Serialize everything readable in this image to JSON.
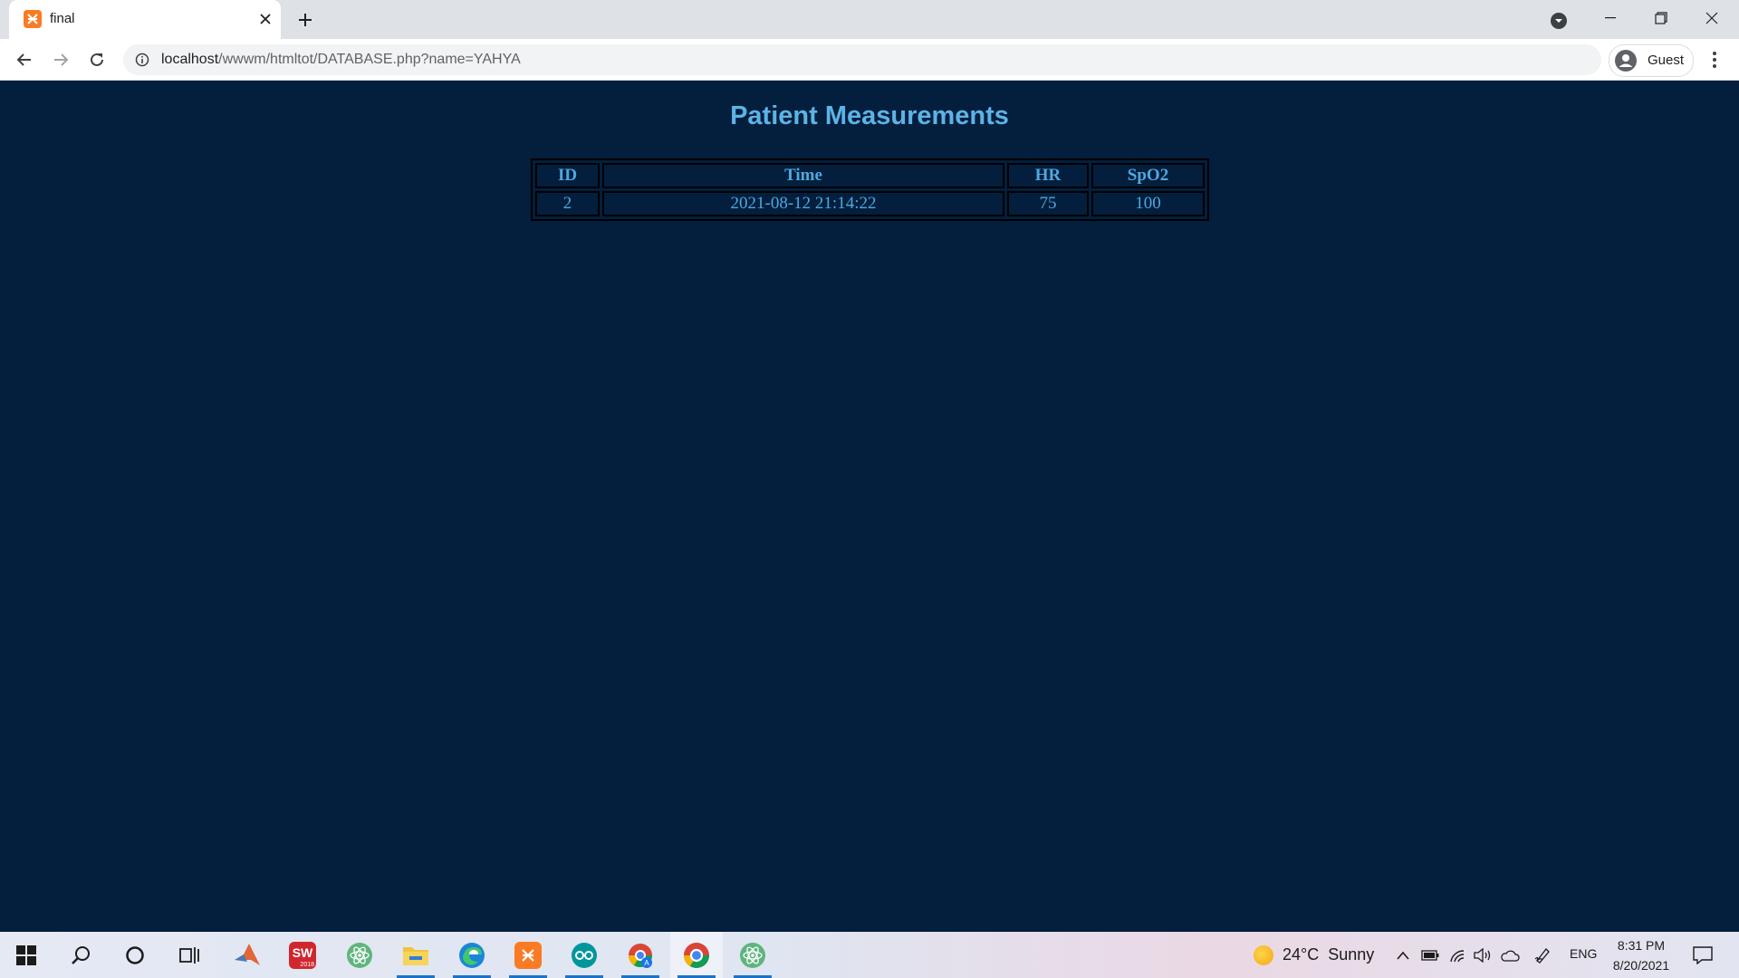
{
  "browser": {
    "tab_title": "final",
    "url_host": "localhost",
    "url_path": "/wwwm/htmltot/DATABASE.php?name=YAHYA",
    "profile_label": "Guest"
  },
  "page": {
    "title": "Patient Measurements",
    "table": {
      "headers": [
        "ID",
        "Time",
        "HR",
        "SpO2"
      ],
      "rows": [
        [
          "2",
          "2021-08-12 21:14:22",
          "75",
          "100"
        ]
      ]
    }
  },
  "taskbar": {
    "apps": [
      "windows-start",
      "search",
      "cortana",
      "task-view",
      "matlab",
      "solidworks",
      "atom",
      "file-explorer",
      "edge",
      "xampp",
      "arduino",
      "chrome-apps",
      "chrome",
      "atom-2"
    ],
    "sw_label": "SW",
    "sw_year": "2018",
    "weather": {
      "temp": "24°C",
      "condition": "Sunny"
    },
    "lang": "ENG",
    "time": "8:31 PM",
    "date": "8/20/2021"
  },
  "colors": {
    "page_bg": "#041f3d",
    "accent_text": "#5db3e6",
    "table_text": "#4ea8df"
  }
}
